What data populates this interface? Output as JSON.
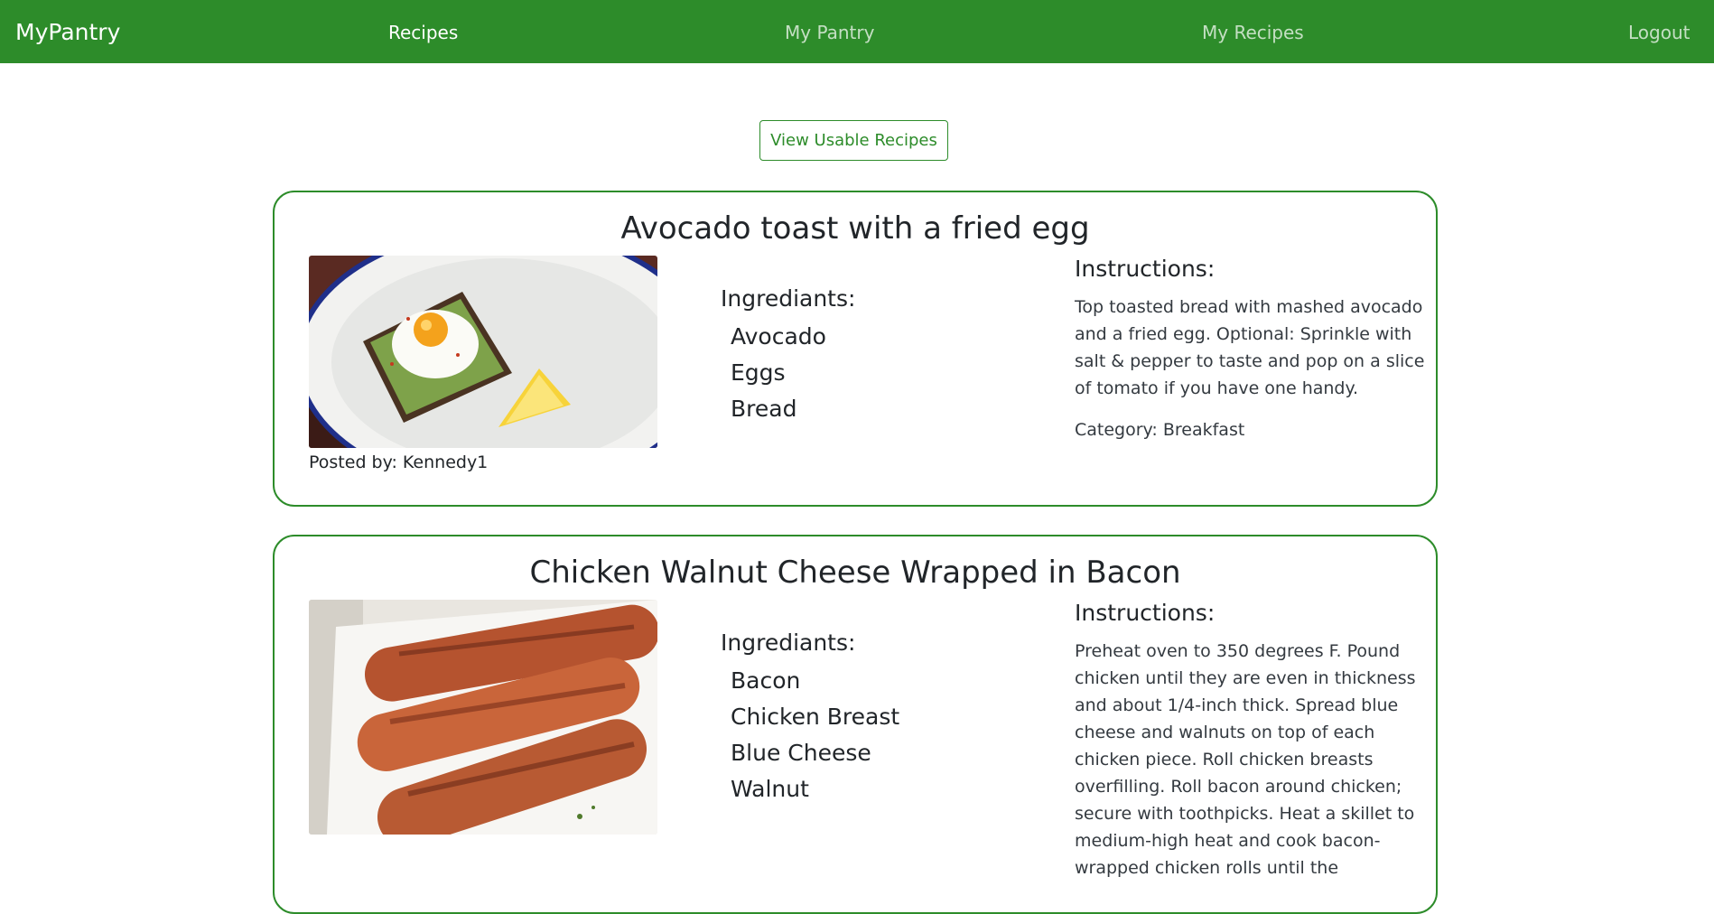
{
  "nav": {
    "brand": "MyPantry",
    "links": [
      "Recipes",
      "My Pantry",
      "My Recipes"
    ],
    "logout": "Logout"
  },
  "actions": {
    "view_usable": "View Usable Recipes"
  },
  "recipes": [
    {
      "title": "Avocado toast with a fried egg",
      "image_alt": "avocado-toast-photo",
      "posted_by": "Posted by: Kennedy1",
      "ingredients_heading": "Ingrediants:",
      "ingredients": [
        "Avocado",
        "Eggs",
        "Bread"
      ],
      "instructions_heading": "Instructions:",
      "instructions": "Top toasted bread with mashed avocado and a fried egg. Optional: Sprinkle with salt & pepper to taste and pop on a slice of tomato if you have one handy.",
      "category": "Category: Breakfast"
    },
    {
      "title": "Chicken Walnut Cheese Wrapped in Bacon",
      "image_alt": "bacon-wrapped-chicken-photo",
      "ingredients_heading": "Ingrediants:",
      "ingredients": [
        "Bacon",
        "Chicken Breast",
        "Blue Cheese",
        "Walnut"
      ],
      "instructions_heading": "Instructions:",
      "instructions": "Preheat oven to 350 degrees F. Pound chicken until they are even in thickness and about 1/4-inch thick. Spread blue cheese and walnuts on top of each chicken piece. Roll chicken breasts overfilling. Roll bacon around chicken; secure with toothpicks. Heat a skillet to medium-high heat and cook bacon-wrapped chicken rolls until the"
    }
  ]
}
